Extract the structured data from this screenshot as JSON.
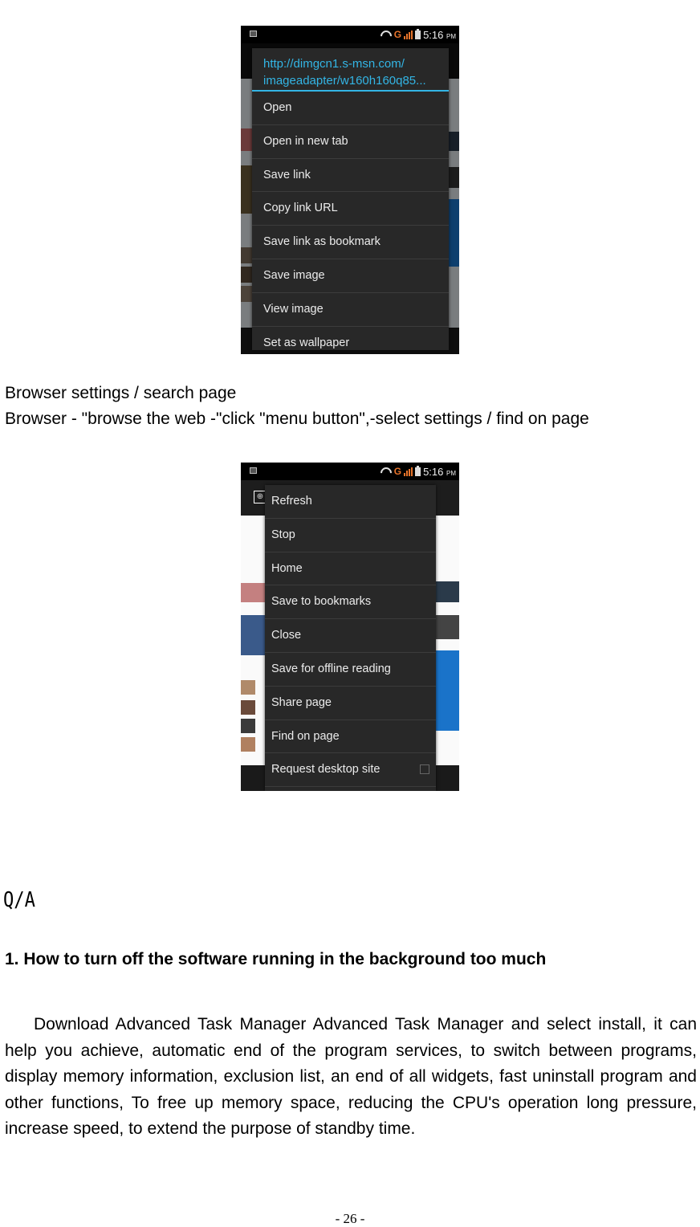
{
  "screenshot1": {
    "statusbar": {
      "time": "5:16",
      "ampm": "PM",
      "network": "G",
      "icons": [
        "notification-icon",
        "wifi-icon",
        "signal-icon",
        "battery-icon"
      ]
    },
    "menu": {
      "title": "http://dimgcn1.s-msn.com/ imageadapter/w160h160q85...",
      "title_line1": "http://dimgcn1.s-msn.com/",
      "title_line2": "imageadapter/w160h160q85...",
      "items": [
        {
          "label": "Open"
        },
        {
          "label": "Open in new tab"
        },
        {
          "label": "Save link"
        },
        {
          "label": "Copy link URL"
        },
        {
          "label": "Save link as bookmark"
        },
        {
          "label": "Save image"
        },
        {
          "label": "View image"
        },
        {
          "label": "Set as wallpaper"
        }
      ]
    }
  },
  "caption": {
    "line1": "Browser settings / search page",
    "line2": "Browser - \"browse the web -\"click \"menu button\",-select settings / find on page"
  },
  "screenshot2": {
    "statusbar": {
      "time": "5:16",
      "ampm": "PM",
      "network": "G"
    },
    "menu": {
      "items": [
        {
          "label": "Refresh"
        },
        {
          "label": "Stop"
        },
        {
          "label": "Home"
        },
        {
          "label": "Save to bookmarks"
        },
        {
          "label": "Close"
        },
        {
          "label": "Save for offline reading"
        },
        {
          "label": "Share page"
        },
        {
          "label": "Find on page"
        },
        {
          "label": "Request desktop site",
          "checkbox": false
        }
      ]
    }
  },
  "qa": {
    "heading": "Q/A",
    "question1": "1. How to turn off the software running in the background too much",
    "answer1": "Download Advanced Task Manager Advanced Task Manager and select install, it can help you achieve, automatic end of the program services, to switch between programs, display memory information, exclusion list, an end of all widgets, fast uninstall program and other functions, To free up memory space, reducing the CPU's operation long pressure, increase speed, to extend the purpose of standby time."
  },
  "page_number": "- 26 -",
  "colors": {
    "accent": "#33b5e5",
    "menu_bg": "#282828",
    "network_orange": "#e8742b"
  }
}
